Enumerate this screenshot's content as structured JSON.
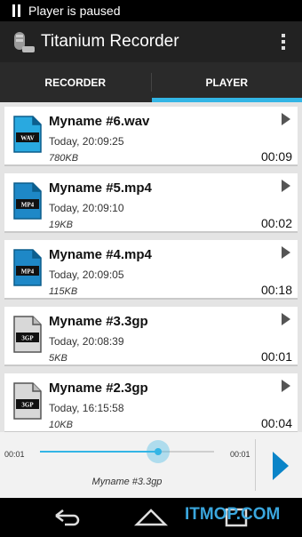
{
  "status_bar": {
    "text": "Player is paused",
    "icon": "pause-icon"
  },
  "action_bar": {
    "title": "Titanium Recorder",
    "app_icon": "microphone-icon",
    "menu_icon": "overflow-menu-icon"
  },
  "tabs": [
    {
      "label": "RECORDER",
      "active": false
    },
    {
      "label": "PLAYER",
      "active": true
    }
  ],
  "recordings": [
    {
      "name": "Myname #6.wav",
      "date": "Today, 20:09:25",
      "size": "780KB",
      "duration": "00:09",
      "type": "WAV",
      "color": "#29a9e0"
    },
    {
      "name": "Myname #5.mp4",
      "date": "Today, 20:09:10",
      "size": "19KB",
      "duration": "00:02",
      "type": "MP4",
      "color": "#1e88c7"
    },
    {
      "name": "Myname #4.mp4",
      "date": "Today, 20:09:05",
      "size": "115KB",
      "duration": "00:18",
      "type": "MP4",
      "color": "#1e88c7"
    },
    {
      "name": "Myname #3.3gp",
      "date": "Today, 20:08:39",
      "size": "5KB",
      "duration": "00:01",
      "type": "3GP",
      "color": "#d8d8d8"
    },
    {
      "name": "Myname #2.3gp",
      "date": "Today, 16:15:58",
      "size": "10KB",
      "duration": "00:04",
      "type": "3GP",
      "color": "#d8d8d8"
    }
  ],
  "player": {
    "elapsed": "00:01",
    "total": "00:01",
    "now_playing": "Myname #3.3gp",
    "progress": 0.68
  },
  "nav_bar": {
    "back": "back-icon",
    "home": "home-icon",
    "recents": "recents-icon"
  },
  "watermark": "ITMOP.COM",
  "colors": {
    "accent": "#33b5e5",
    "play": "#0a84c8"
  }
}
